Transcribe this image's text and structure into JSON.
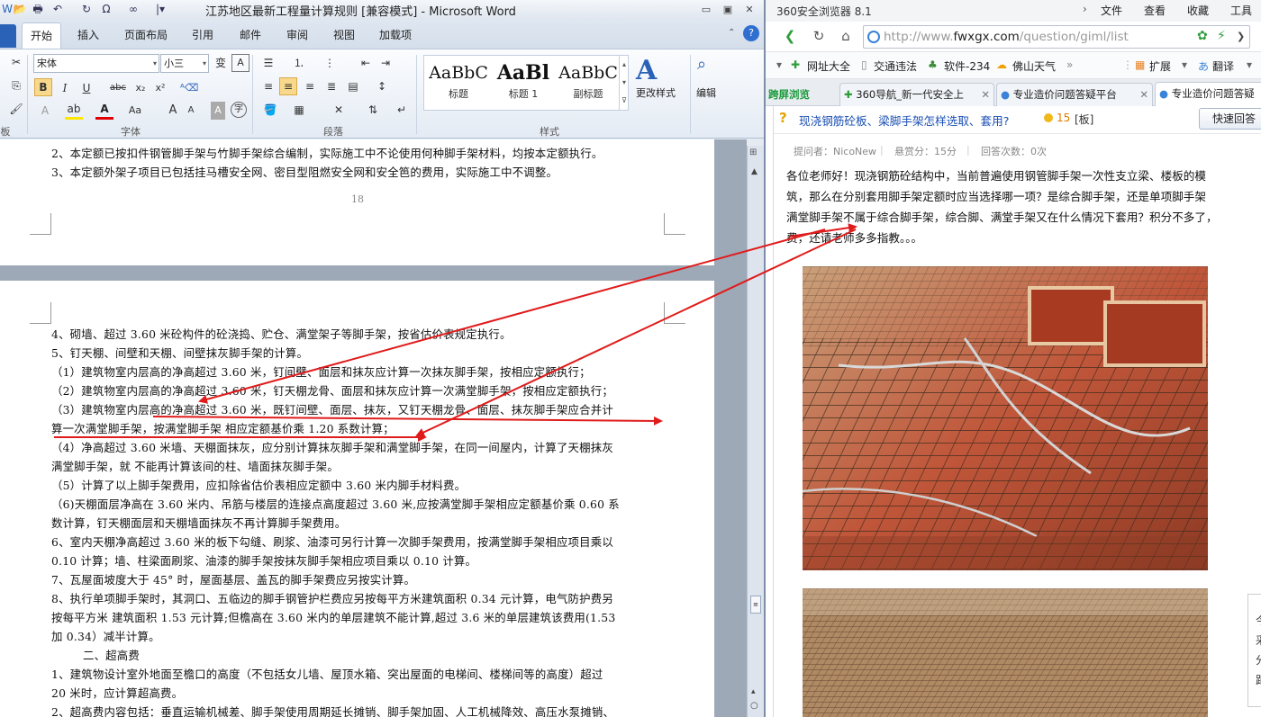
{
  "word": {
    "title": "江苏地区最新工程量计算规则 [兼容模式] - Microsoft Word",
    "window_controls": {
      "minimize": "▭",
      "restore": "▣",
      "close": "✕"
    },
    "tabs": [
      "开始",
      "插入",
      "页面布局",
      "引用",
      "邮件",
      "审阅",
      "视图",
      "加载项"
    ],
    "font": {
      "name": "宋体",
      "size": "小三"
    },
    "groups": {
      "clipboard": "板",
      "font": "字体",
      "paragraph": "段落",
      "styles": "样式"
    },
    "styles": [
      {
        "preview": "AaBbC",
        "label": "标题"
      },
      {
        "preview": "AaBl",
        "label": "标题 1"
      },
      {
        "preview": "AaBbC",
        "label": "副标题"
      }
    ],
    "change_styles": "更改样式",
    "edit": "编辑",
    "page_top_lines": [
      "2、本定额已按扣件钢管脚手架与竹脚手架综合编制，实际施工中不论使用何种脚手架材料，均按本定额执行。",
      "3、本定额外架子项目已包括挂马槽安全网、密目型阻燃安全网和安全笆的费用，实际施工中不调整。"
    ],
    "page_number": "18",
    "body_lines": [
      "4、砌墙、超过 3.60 米砼构件的砼浇捣、贮仓、满堂架子等脚手架，按省估价表规定执行。",
      "5、钉天棚、间壁和天棚、间壁抹灰脚手架的计算。",
      "（1）建筑物室内层高的净高超过 3.60 米，钉间壁、面层和抹灰应计算一次抹灰脚手架，按相应定额执行；",
      "（2）建筑物室内层高的净高超过 3.60 米，钉天棚龙骨、面层和抹灰应计算一次满堂脚手架，按相应定额执行；",
      "（3）建筑物室内层高的净高超过 3.60 米，既钉间壁、面层、抹灰，又钉天棚龙骨、面层、抹灰脚手架应合并计",
      "算一次满堂脚手架，按满堂脚手架 相应定额基价乘 1.20 系数计算；",
      "（4）净高超过 3.60 米墙、天棚面抹灰，应分别计算抹灰脚手架和满堂脚手架，在同一间屋内，计算了天棚抹灰",
      "满堂脚手架，就 不能再计算该间的柱、墙面抹灰脚手架。",
      "（5）计算了以上脚手架费用，应扣除省估价表相应定额中 3.60 米内脚手材料费。",
      "（6)天棚面层净高在 3.60 米内、吊筋与楼层的连接点高度超过 3.60 米,应按满堂脚手架相应定额基价乘 0.60 系",
      "数计算，钉天棚面层和天棚墙面抹灰不再计算脚手架费用。",
      "6、室内天棚净高超过 3.60 米的板下勾缝、刷浆、油漆可另行计算一次脚手架费用，按满堂脚手架相应项目乘以",
      "0.10 计算；墙、柱梁面刷浆、油漆的脚手架按抹灰脚手架相应项目乘以 0.10 计算。",
      "7、瓦屋面坡度大于 45° 时，屋面基层、盖瓦的脚手架费应另按实计算。",
      "8、执行单项脚手架时，其洞口、五临边的脚手钢管护栏费应另按每平方米建筑面积 0.34 元计算，电气防护费另",
      "按每平方米 建筑面积 1.53 元计算;但檐高在 3.60 米内的单层建筑不能计算,超过 3.6 米的单层建筑该费用(1.53",
      "加 0.34）减半计算。",
      "二、超高费",
      "1、建筑物设计室外地面至檐口的高度（不包括女儿墙、屋顶水箱、突出屋面的电梯间、楼梯间等的高度）超过",
      "20 米时，应计算超高费。",
      "2、超高费内容包括：垂直运输机械差、脚手架使用周期延长摊销、脚手架加固、人工机械降效、高压水泵摊销、"
    ]
  },
  "browser": {
    "title": "360安全浏览器 8.1",
    "menu": [
      "文件",
      "查看",
      "收藏",
      "工具"
    ],
    "url_prefix": "http://www.",
    "url_domain": "fwxgx.com",
    "url_path": "/question/giml/list",
    "bookmarks": [
      "网址大全",
      "交通违法",
      "软件-234",
      "佛山天气",
      "扩展",
      "翻译"
    ],
    "tabs": [
      "跨屏浏览",
      "360导航_新一代安全上",
      "专业造价问题答疑平台",
      "专业造价问题答疑"
    ],
    "question_title": "现浇钢筋砼板、梁脚手架怎样选取、套用?",
    "coins": "15",
    "tag": "[板]",
    "quick_answer": "快速回答",
    "meta": {
      "asker": "提问者：NicoNew",
      "reward": "悬赏分：15分",
      "answers": "回答次数：0次"
    },
    "question_lines": [
      "各位老师好！现浇钢筋砼结构中，当前普遍使用钢管脚手架一次性支立梁、楼板的模",
      "筑，那么在分别套用脚手架定额时应当选择哪一项？是综合脚手架，还是单项脚手架",
      "满堂脚手架不属于综合脚手架，综合脚、满堂手架又在什么情况下套用？积分不多了，",
      "费，还请老师多多指教。。。"
    ],
    "side_chars": [
      "今",
      "采",
      "分",
      "距"
    ]
  },
  "colors": {
    "arrow": "#e01b1b",
    "link": "#1a4fb3",
    "word_accent": "#2a62b8"
  }
}
